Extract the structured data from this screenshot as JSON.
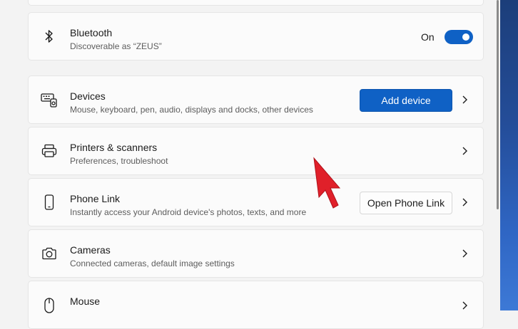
{
  "bluetooth": {
    "title": "Bluetooth",
    "subtitle": "Discoverable as “ZEUS”",
    "toggle_label": "On",
    "toggle_state": "on",
    "icon": "bluetooth-icon"
  },
  "devices": {
    "title": "Devices",
    "subtitle": "Mouse, keyboard, pen, audio, displays and docks, other devices",
    "button_label": "Add device",
    "icon": "devices-icon"
  },
  "printers": {
    "title": "Printers & scanners",
    "subtitle": "Preferences, troubleshoot",
    "icon": "printer-icon"
  },
  "phone_link": {
    "title": "Phone Link",
    "subtitle": "Instantly access your Android device's photos, texts, and more",
    "button_label": "Open Phone Link",
    "icon": "phone-icon"
  },
  "cameras": {
    "title": "Cameras",
    "subtitle": "Connected cameras, default image settings",
    "icon": "camera-icon"
  },
  "mouse": {
    "title": "Mouse",
    "icon": "mouse-icon"
  },
  "colors": {
    "accent": "#0f61c5",
    "cursor": "#e0202a",
    "background": "#f3f3f3",
    "card": "#fbfbfb"
  }
}
